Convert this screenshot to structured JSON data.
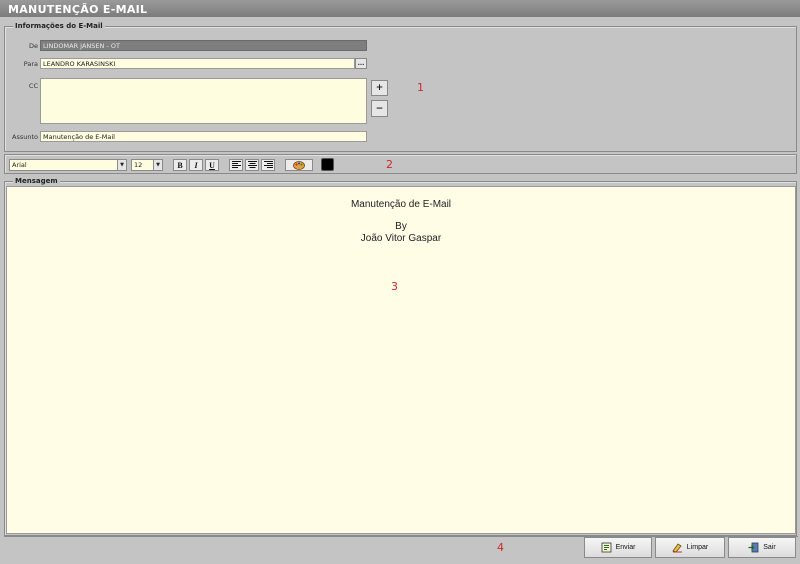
{
  "window": {
    "title": "MANUTENÇÃO E-MAIL"
  },
  "email_info": {
    "legend": "Informações do E-Mail",
    "from_label": "De",
    "from_value": "LINDOMAR JANSEN - OT",
    "to_label": "Para",
    "to_value": "LEANDRO KARASINSKI",
    "browse_label": "...",
    "cc_label": "CC",
    "cc_add_label": "+",
    "cc_remove_label": "−",
    "subject_label": "Assunto",
    "subject_value": "Manutenção de E-Mail",
    "marker": "1"
  },
  "toolbar": {
    "font_name": "Arial",
    "font_size": "12",
    "bold_label": "B",
    "italic_label": "I",
    "underline_label": "U",
    "text_color": "#000000",
    "marker": "2"
  },
  "message": {
    "legend": "Mensagem",
    "lines": [
      "Manutenção de E-Mail",
      "By",
      "João Vitor Gaspar"
    ],
    "marker": "3"
  },
  "actions": {
    "marker": "4",
    "send_label": "Enviar",
    "clear_label": "Limpar",
    "exit_label": "Sair"
  }
}
